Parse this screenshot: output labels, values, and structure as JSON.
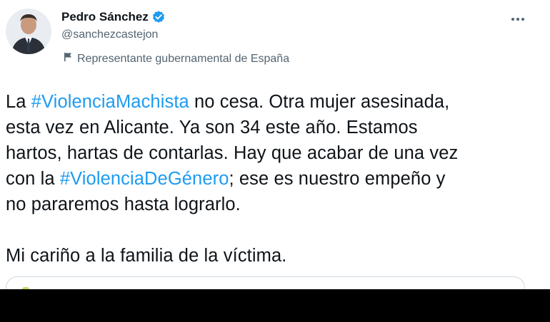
{
  "author": {
    "name": "Pedro Sánchez",
    "handle": "@sanchezcastejon",
    "label": "Representante gubernamental de España"
  },
  "tweet": {
    "line1": {
      "pre": "La ",
      "hashtag": "#ViolenciaMachista",
      "post": " no cesa. Otra mujer asesinada,"
    },
    "line2": "esta vez en Alicante. Ya son 34 este año. Estamos",
    "line3": "hartos, hartas de contarlas. Hay que acabar de una vez",
    "line4": {
      "pre": "con la ",
      "hashtag": "#ViolenciaDeGénero",
      "post": "; ese es nuestro empeño y"
    },
    "line5": "no pararemos hasta lograrlo.",
    "line6": "Mi cariño a la familia de la víctima."
  },
  "colors": {
    "link": "#1d9bf0",
    "verified": "#1d9bf0",
    "secondary_text": "#536471"
  },
  "icons": {
    "verified": "verified-badge-icon",
    "flag": "flag-icon",
    "more": "more-options-icon"
  }
}
